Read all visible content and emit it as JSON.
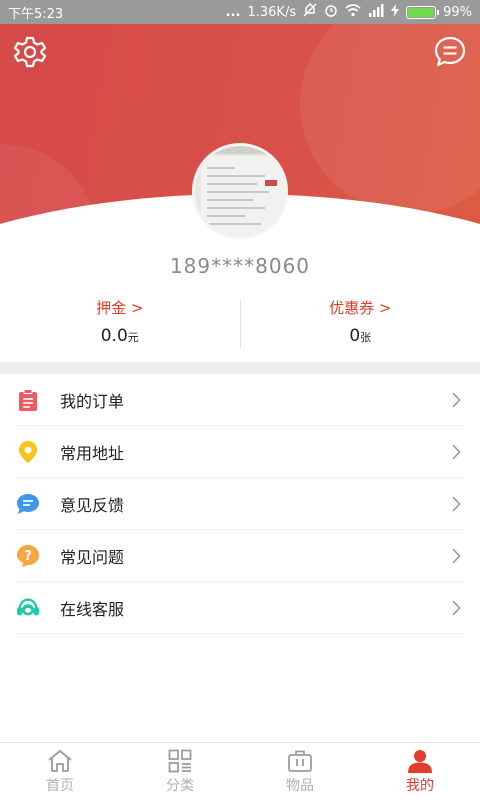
{
  "status_bar": {
    "time": "下午5:23",
    "dots": "...",
    "network_speed": "1.36K/s",
    "battery": "99%",
    "battery_level": 0.99
  },
  "profile": {
    "phone": "189****8060"
  },
  "stats": {
    "deposit_label": "押金 >",
    "deposit_value": "0.0",
    "deposit_unit": "元",
    "coupon_label": "优惠券 >",
    "coupon_value": "0",
    "coupon_unit": "张"
  },
  "menu": {
    "items": [
      {
        "label": "我的订单",
        "icon": "clipboard-icon",
        "color": "#ef5a62"
      },
      {
        "label": "常用地址",
        "icon": "location-pin-icon",
        "color": "#f5c518"
      },
      {
        "label": "意见反馈",
        "icon": "chat-bubble-icon",
        "color": "#3d97ea"
      },
      {
        "label": "常见问题",
        "icon": "question-icon",
        "color": "#f5a742"
      },
      {
        "label": "在线客服",
        "icon": "headset-icon",
        "color": "#22c9a5"
      }
    ]
  },
  "tabbar": {
    "tabs": [
      {
        "label": "首页",
        "icon": "home-icon"
      },
      {
        "label": "分类",
        "icon": "category-grid-icon"
      },
      {
        "label": "物品",
        "icon": "bag-icon"
      },
      {
        "label": "我的",
        "icon": "user-icon",
        "active": true
      }
    ]
  },
  "colors": {
    "accent": "#e23d2d",
    "header_bg": "#d64a4a"
  }
}
